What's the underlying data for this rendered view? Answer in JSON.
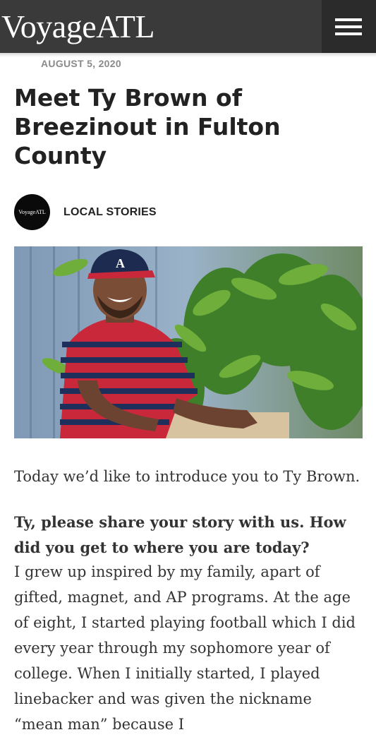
{
  "header": {
    "logo_text": "VoyageATL",
    "menu_icon": "hamburger-menu-icon"
  },
  "article": {
    "date": "AUGUST 5, 2020",
    "title": "Meet Ty Brown of Breezinout in Fulton County",
    "avatar_text": "VoyageATL",
    "category": "LOCAL STORIES",
    "hero_image": "Ty Brown smiling, wearing a navy baseball cap and a red and navy striped t-shirt, seated in front of green plants and a blue wall",
    "intro": "Today we’d like to introduce you to Ty Brown.",
    "question": "Ty, please share your story with us. How did you get to where you are today?",
    "answer": "I grew up inspired by my family, apart of gifted, magnet, and AP programs. At the age of eight, I started playing football which I did every year through my sophomore year of college. When I initially started, I played linebacker and was given the nickname “mean man” because I"
  },
  "colors": {
    "header_bg": "#3a3a3a",
    "menu_bg": "#2b2b2b",
    "title_text": "#222222",
    "body_text": "#333333",
    "date_text": "#8a8a8a"
  }
}
